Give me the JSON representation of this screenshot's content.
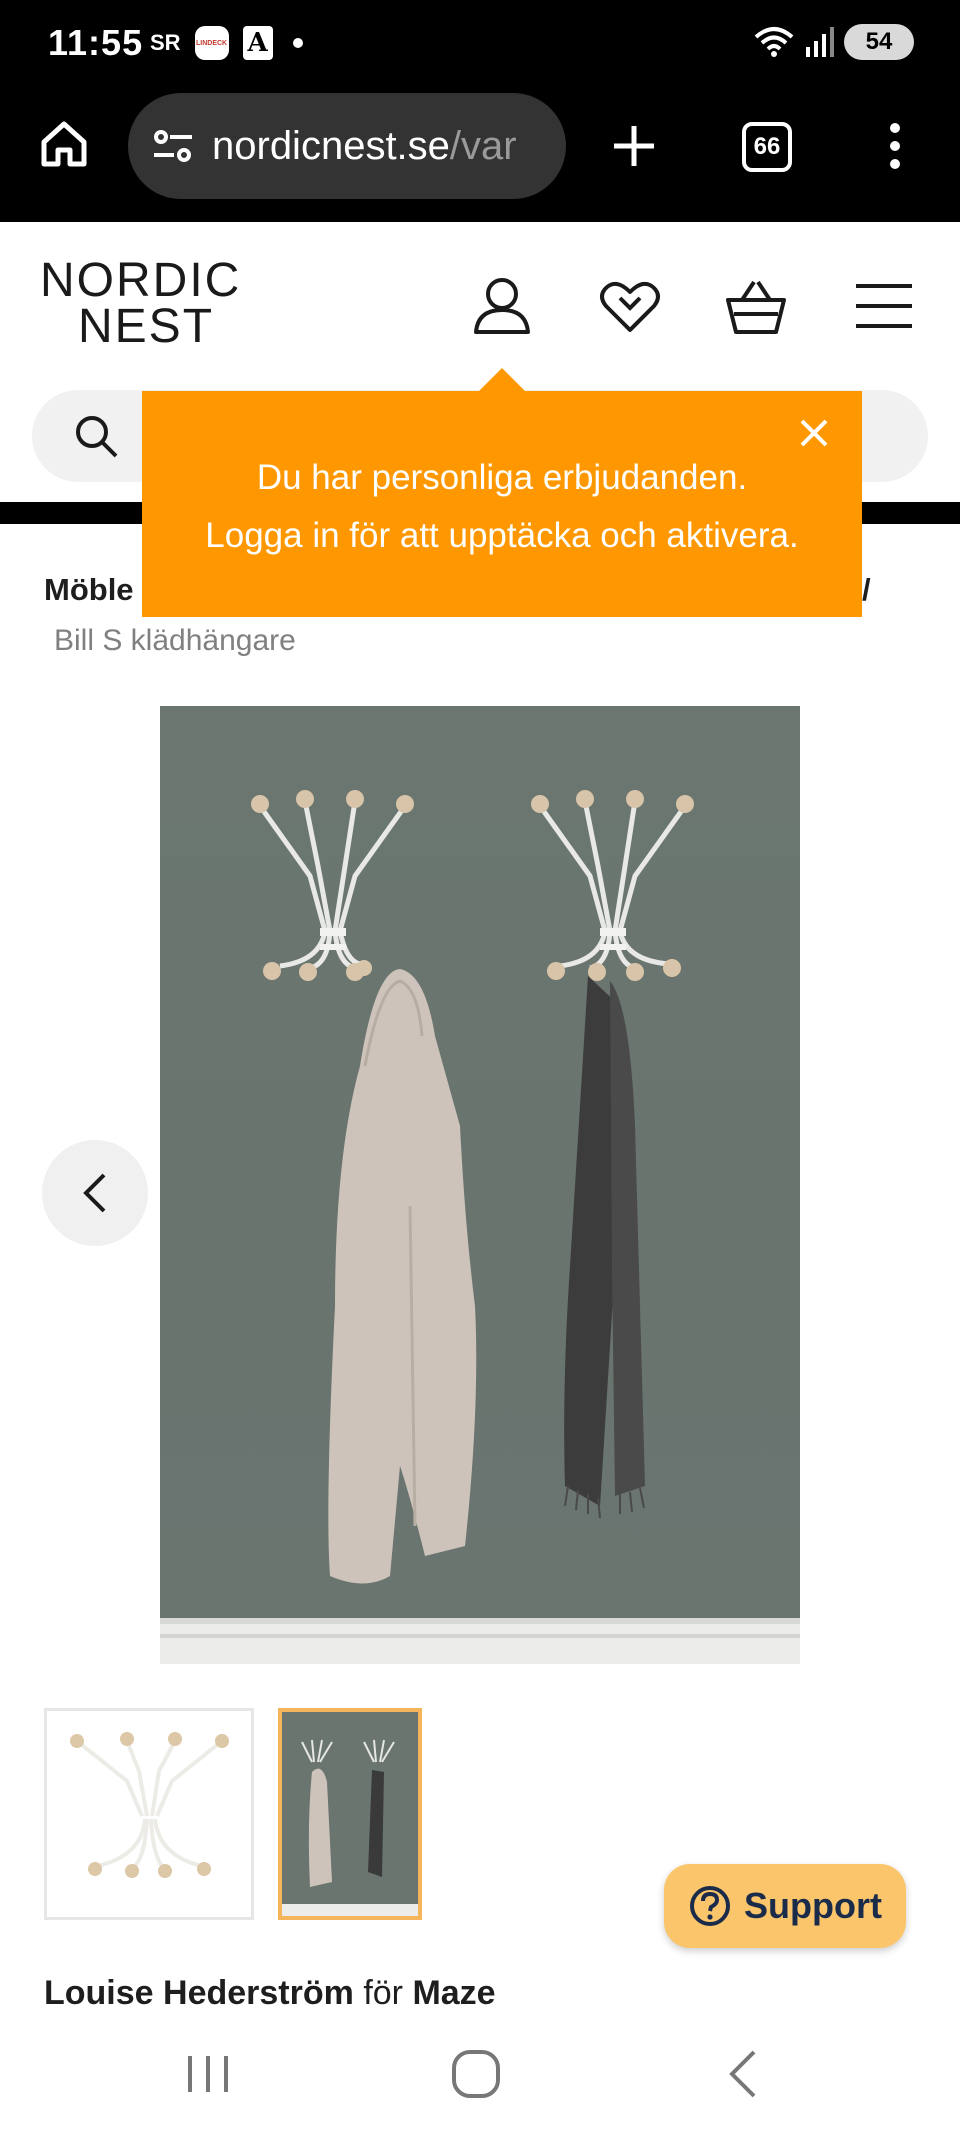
{
  "status_bar": {
    "time": "11:55",
    "sr_label": "SR",
    "lindeck_label": "LINDECK",
    "a_label": "A",
    "battery": "54"
  },
  "browser": {
    "url_host": "nordicnest.se",
    "url_path": "/var",
    "tab_count": "66"
  },
  "site": {
    "logo_line1": "NORDIC",
    "logo_line2": "NEST",
    "search_placeholder": ""
  },
  "tooltip": {
    "line1": "Du har personliga erbjudanden.",
    "line2": "Logga in för att upptäcka och aktivera."
  },
  "breadcrumb": {
    "first": "Möble",
    "tail": "/",
    "current": "Bill S klädhängare"
  },
  "product": {
    "designer": "Louise Hederström",
    "designer_for": "för",
    "brand": "Maze"
  },
  "support": {
    "label": "Support"
  },
  "icons": {
    "home": "home-icon",
    "site_settings": "tune-icon",
    "new_tab": "plus-icon",
    "menu": "more-vert-icon",
    "account": "user-icon",
    "wishlist": "heart-icon",
    "cart": "basket-icon",
    "hamburger": "menu-icon",
    "search": "search-icon",
    "close": "close-icon",
    "prev": "chevron-left-icon",
    "support": "help-icon"
  },
  "colors": {
    "accent_orange": "#ff9800",
    "support_yellow": "#fbc56b",
    "thumb_border": "#f4b55c",
    "wall_green": "#6b7670"
  }
}
